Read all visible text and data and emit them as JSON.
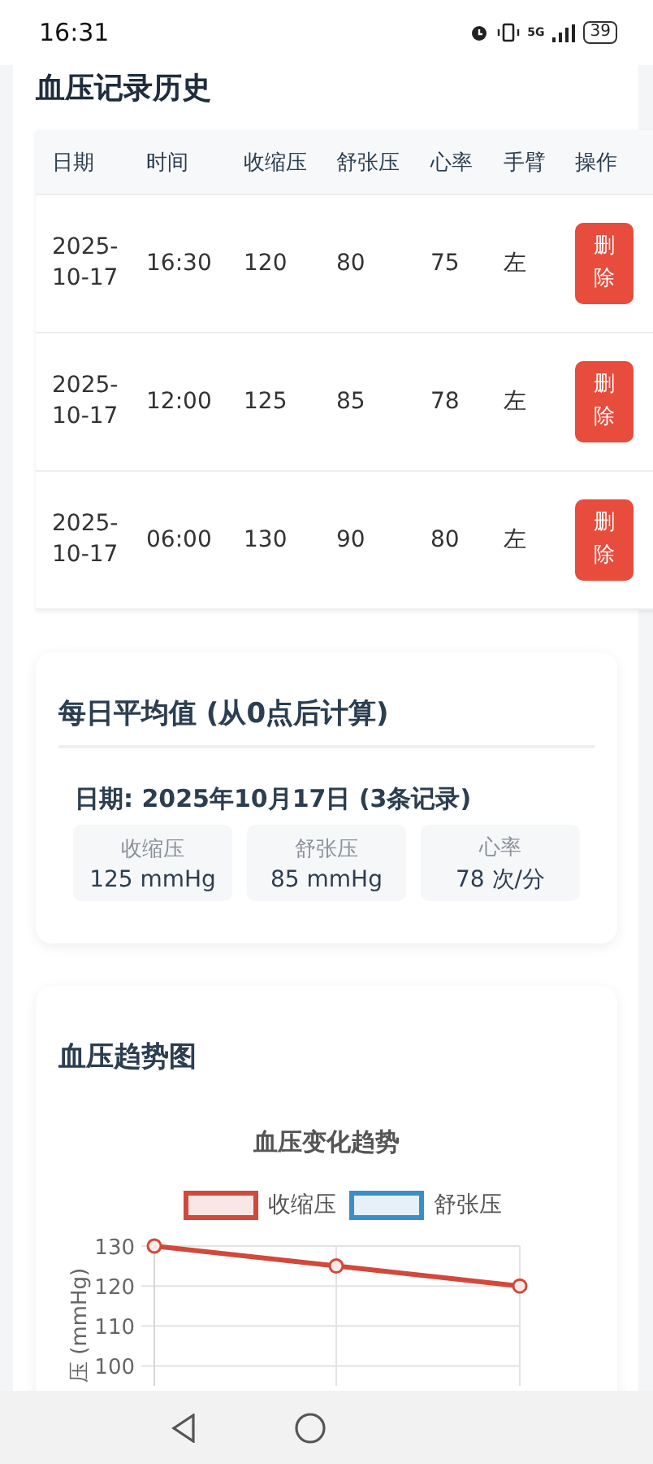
{
  "status_bar": {
    "time": "16:31",
    "network": "5G",
    "battery": "39"
  },
  "history": {
    "title": "血压记录历史",
    "columns": [
      "日期",
      "时间",
      "收缩压",
      "舒张压",
      "心率",
      "手臂",
      "操作"
    ],
    "rows": [
      {
        "date": "2025-10-17",
        "time": "16:30",
        "systolic": "120",
        "diastolic": "80",
        "heart_rate": "75",
        "arm": "左",
        "action": "删除"
      },
      {
        "date": "2025-10-17",
        "time": "12:00",
        "systolic": "125",
        "diastolic": "85",
        "heart_rate": "78",
        "arm": "左",
        "action": "删除"
      },
      {
        "date": "2025-10-17",
        "time": "06:00",
        "systolic": "130",
        "diastolic": "90",
        "heart_rate": "80",
        "arm": "左",
        "action": "删除"
      }
    ]
  },
  "daily_average": {
    "title": "每日平均值 (从0点后计算)",
    "date_line": "日期: 2025年10月17日 (3条记录)",
    "stats": [
      {
        "label": "收缩压",
        "value": "125 mmHg"
      },
      {
        "label": "舒张压",
        "value": "85 mmHg"
      },
      {
        "label": "心率",
        "value": "78 次/分"
      }
    ]
  },
  "trend": {
    "title": "血压趋势图",
    "chart_data": {
      "type": "line",
      "title": "血压变化趋势",
      "ylabel": "压 (mmHg)",
      "ylim": [
        95,
        130
      ],
      "grid": true,
      "yticks": [
        100,
        110,
        120,
        130
      ],
      "series": [
        {
          "name": "收缩压",
          "color": "#d0493b",
          "marker": true,
          "values": [
            130,
            125,
            120
          ]
        },
        {
          "name": "舒张压",
          "color": "#3a8fc8",
          "values": [
            null,
            null,
            null
          ]
        }
      ]
    }
  }
}
